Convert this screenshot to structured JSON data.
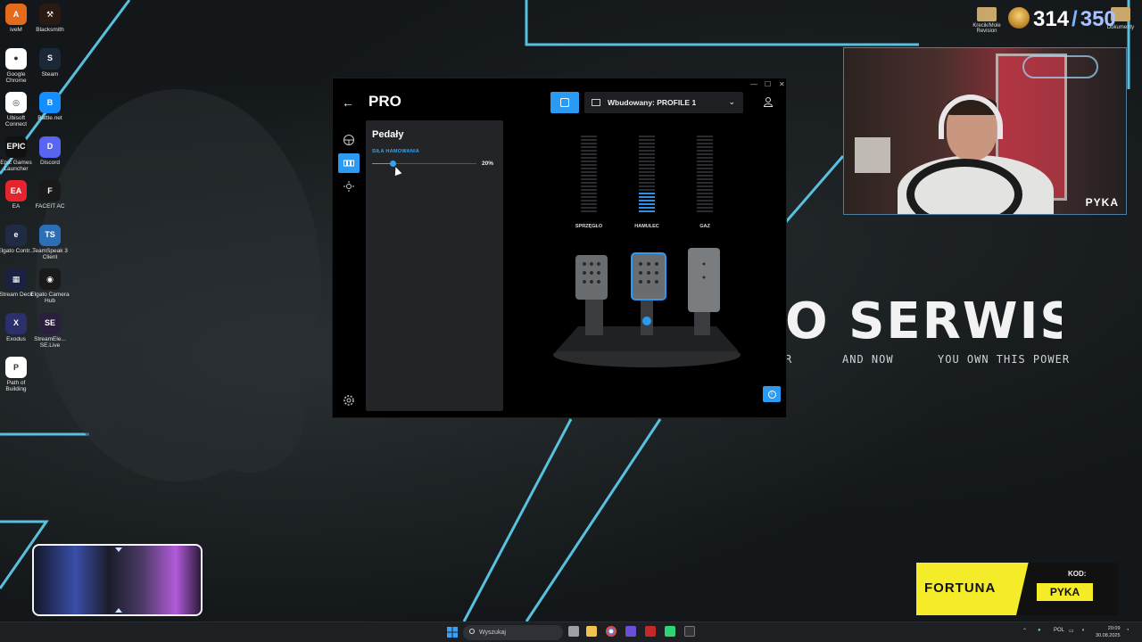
{
  "desktop": {
    "icons": [
      {
        "label": "iveM",
        "color": "#e46a1c",
        "glyph": "A"
      },
      {
        "label": "Blacksmith",
        "color": "#2a1a14",
        "glyph": "⚒"
      },
      {
        "label": "Google Chrome",
        "color": "#ffffff",
        "glyph": "●"
      },
      {
        "label": "Steam",
        "color": "#1b2838",
        "glyph": "S"
      },
      {
        "label": "Ubisoft Connect",
        "color": "#ffffff",
        "glyph": "◎"
      },
      {
        "label": "Battle.net",
        "color": "#148eff",
        "glyph": "B"
      },
      {
        "label": "Epic Games Launcher",
        "color": "#111111",
        "glyph": "EPIC"
      },
      {
        "label": "Discord",
        "color": "#5865f2",
        "glyph": "D"
      },
      {
        "label": "EA",
        "color": "#e5242e",
        "glyph": "EA"
      },
      {
        "label": "FACEIT AC",
        "color": "#1a1a1a",
        "glyph": "F"
      },
      {
        "label": "Elgato Contr...",
        "color": "#1f2a44",
        "glyph": "e"
      },
      {
        "label": "TeamSpeak 3 Client",
        "color": "#2c6fb6",
        "glyph": "TS"
      },
      {
        "label": "Stream Deck",
        "color": "#1b2140",
        "glyph": "▦"
      },
      {
        "label": "Elgato Camera Hub",
        "color": "#1a1a1a",
        "glyph": "◉"
      },
      {
        "label": "Exodus",
        "color": "#2b2f6b",
        "glyph": "X"
      },
      {
        "label": "StreamEle... SE.Live",
        "color": "#2a1f3d",
        "glyph": "SE"
      },
      {
        "label": "Path of Building",
        "color": "#ffffff",
        "glyph": "P"
      }
    ],
    "overlay": {
      "title": "O SERWIS",
      "sub_left": "R",
      "sub_mid": "AND NOW",
      "sub_right": "YOU OWN THIS POWER"
    },
    "top_right": {
      "folder_labels": [
        "Krecik/Mole Revision",
        "Dokumenty"
      ],
      "count": "314",
      "slash": "/",
      "goal": "350"
    },
    "webcam": {
      "name": "PYKA"
    }
  },
  "app": {
    "title": "PRO",
    "profile": "Wbudowany: PROFILE 1",
    "panel": {
      "title": "Pedały",
      "setting_label": "SIŁA HAMOWANIA",
      "value_text": "20%",
      "value": 0.2
    },
    "meters": [
      {
        "label": "SPRZĘGŁO",
        "level": 0
      },
      {
        "label": "HAMULEC",
        "level": 0.25
      },
      {
        "label": "GAZ",
        "level": 0
      }
    ]
  },
  "ad": {
    "brand": "FORTUNA",
    "code_label": "KOD:",
    "code": "PYKA"
  },
  "taskbar": {
    "search_placeholder": "Wyszukaj",
    "lang": "POL",
    "time": "20:09",
    "date": "30.08.2025"
  },
  "colors": {
    "accent": "#2b9af3",
    "neon_line": "#5fd3f3",
    "ad_yellow": "#f4ec28"
  }
}
